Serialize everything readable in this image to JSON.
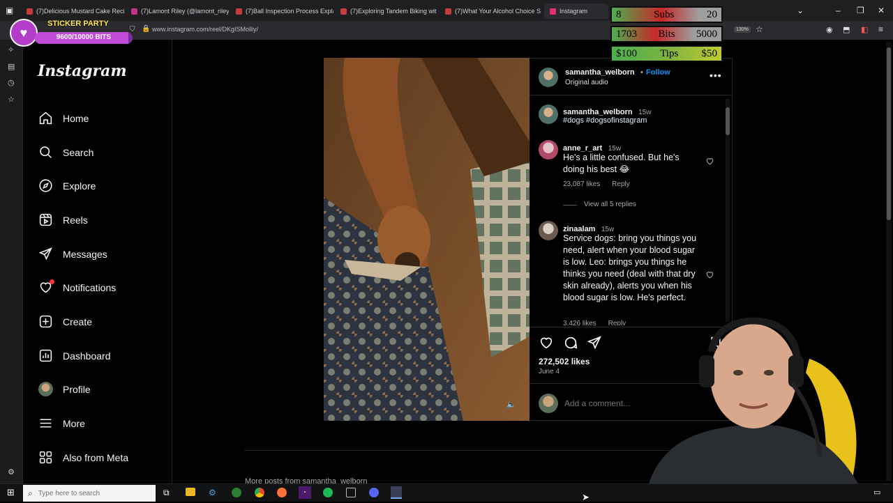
{
  "browser": {
    "tabs": [
      {
        "title": "(7)Delicious Mustard Cake Reci"
      },
      {
        "title": "(7)Lamont Riley (@lamont_riley"
      },
      {
        "title": "(7)Ball Inspection Process Explai"
      },
      {
        "title": "(7)Exploring Tandem Biking wit"
      },
      {
        "title": "(7)What Your Alcohol Choice S"
      },
      {
        "title": "Instagram"
      }
    ],
    "url": "www.instagram.com/reel/DKgISMolliy/",
    "zoom": "130%"
  },
  "stream_overlay": {
    "sticker": {
      "title": "STICKER PARTY",
      "progress_text": "9600/10000 BITS",
      "progress": 0.96
    },
    "stats": [
      {
        "current": "8",
        "label": "Subs",
        "goal": "20",
        "progress": 0.4
      },
      {
        "current": "1703",
        "label": "Bits",
        "goal": "5000",
        "progress": 0.34
      },
      {
        "current": "$100",
        "label": "Tips",
        "goal": "$50",
        "progress": 1.0
      }
    ]
  },
  "sidebar": {
    "logo": "Instagram",
    "items": [
      {
        "label": "Home",
        "icon": "home-icon"
      },
      {
        "label": "Search",
        "icon": "search-icon"
      },
      {
        "label": "Explore",
        "icon": "compass-icon"
      },
      {
        "label": "Reels",
        "icon": "reels-icon"
      },
      {
        "label": "Messages",
        "icon": "paper-plane-icon"
      },
      {
        "label": "Notifications",
        "icon": "heart-icon"
      },
      {
        "label": "Create",
        "icon": "plus-square-icon"
      },
      {
        "label": "Dashboard",
        "icon": "bar-chart-icon"
      },
      {
        "label": "Profile",
        "icon": "avatar-icon"
      },
      {
        "label": "More",
        "icon": "menu-icon"
      },
      {
        "label": "Also from Meta",
        "icon": "meta-grid-icon"
      }
    ]
  },
  "post": {
    "author": "samantha_welborn",
    "follow_label": "Follow",
    "audio": "Original audio",
    "caption": {
      "user": "samantha_welborn",
      "time": "15w",
      "text": "#dogs #dogsofinstagram"
    },
    "comments": [
      {
        "user": "anne_r_art",
        "time": "15w",
        "text": "He's a little confused. But he's doing his best 😂",
        "likes": "23,087 likes",
        "reply": "Reply",
        "view_replies": "View all 5 replies"
      },
      {
        "user": "zinaalam",
        "time": "15w",
        "text": "Service dogs: bring you things you need, alert when your blood sugar is low. Leo: brings you things he thinks you need (deal with that dry skin already), alerts you when his blood sugar is low. He's perfect.",
        "likes": "3,426 likes",
        "reply": "Reply"
      }
    ],
    "likes": "272,502 likes",
    "date": "June 4",
    "comment_placeholder": "Add a comment..."
  },
  "below": {
    "more_posts": "More posts from samantha_welborn"
  },
  "taskbar": {
    "search_placeholder": "Type here to search"
  },
  "colors": {
    "accent": "#0095f6",
    "hashtag": "#e0f1ff",
    "notif_dot": "#ff3040"
  }
}
